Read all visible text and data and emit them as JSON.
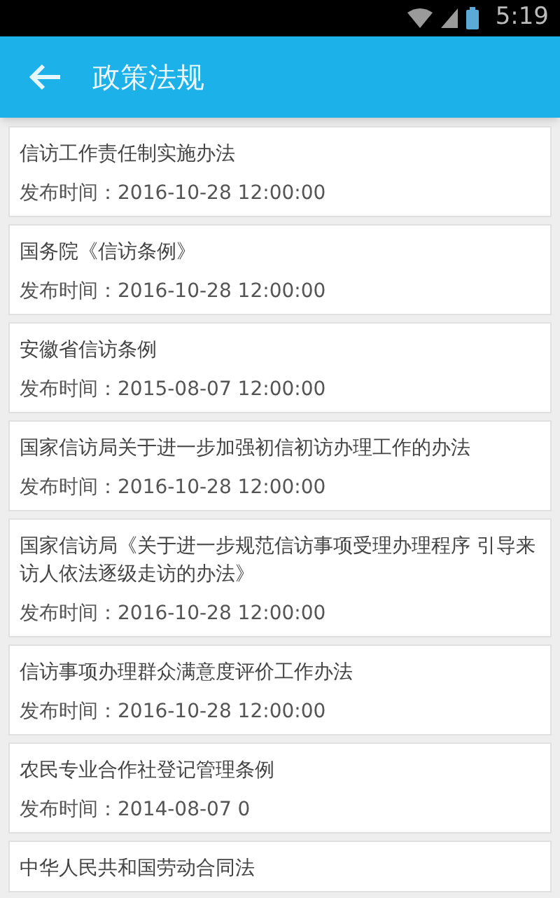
{
  "status_bar": {
    "time": "5:19"
  },
  "app_bar": {
    "title": "政策法规"
  },
  "items": [
    {
      "title": "信访工作责任制实施办法",
      "date": "发布时间：2016-10-28 12:00:00"
    },
    {
      "title": "国务院《信访条例》",
      "date": "发布时间：2016-10-28 12:00:00"
    },
    {
      "title": "安徽省信访条例",
      "date": "发布时间：2015-08-07 12:00:00"
    },
    {
      "title": "国家信访局关于进一步加强初信初访办理工作的办法",
      "date": "发布时间：2016-10-28 12:00:00"
    },
    {
      "title": "国家信访局《关于进一步规范信访事项受理办理程序 引导来访人依法逐级走访的办法》",
      "date": "发布时间：2016-10-28 12:00:00"
    },
    {
      "title": "信访事项办理群众满意度评价工作办法",
      "date": "发布时间：2016-10-28 12:00:00"
    },
    {
      "title": "农民专业合作社登记管理条例",
      "date": "发布时间：2014-08-07 0"
    },
    {
      "title": "中华人民共和国劳动合同法"
    }
  ]
}
